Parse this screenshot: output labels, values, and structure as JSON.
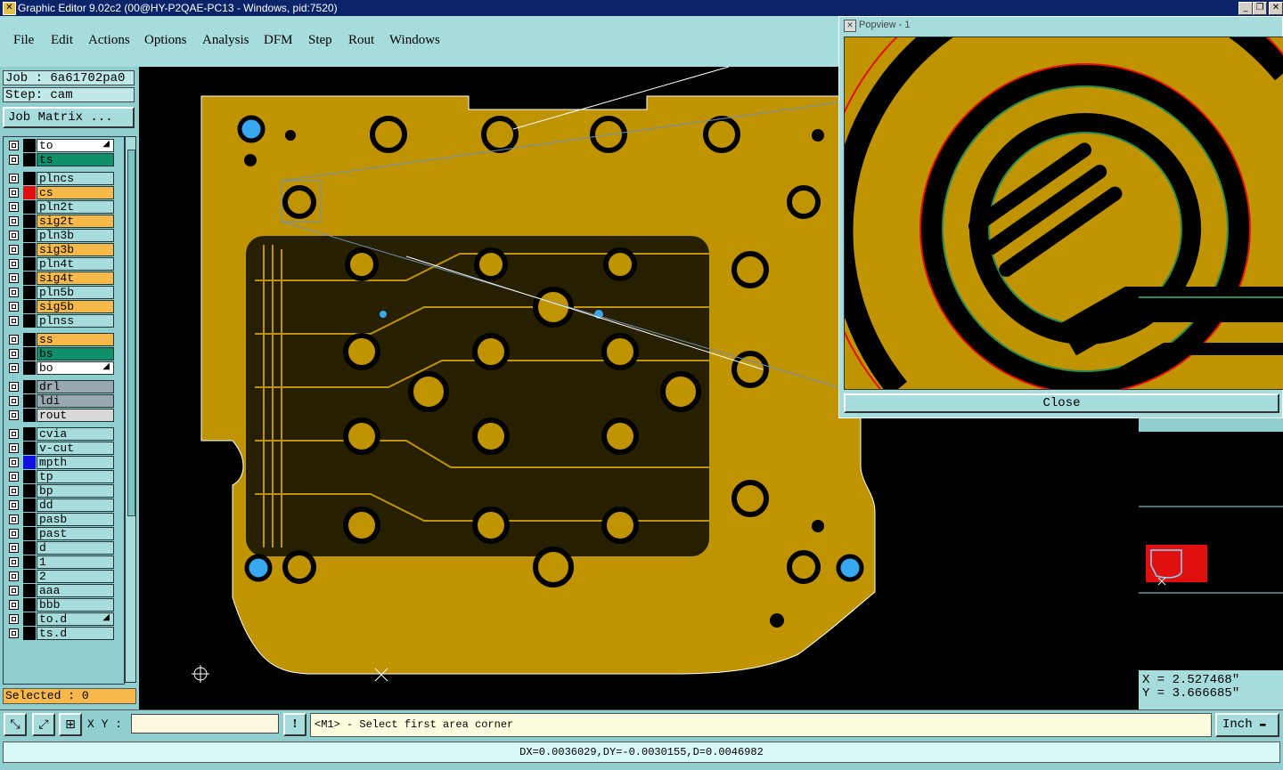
{
  "window": {
    "title": "Graphic Editor 9.02c2 (00@HY-P2QAE-PC13 - Windows, pid:7520)"
  },
  "menu": [
    "File",
    "Edit",
    "Actions",
    "Options",
    "Analysis",
    "DFM",
    "Step",
    "Rout",
    "Windows"
  ],
  "job": {
    "job_line": "Job : 6a61702pa0",
    "step_line": "Step: cam",
    "matrix_button": "Job Matrix ..."
  },
  "layers": [
    {
      "name": "to",
      "color": "#ffffff",
      "swatch": "#000000",
      "arrow": true
    },
    {
      "name": "ts",
      "color": "#0f8f6a",
      "swatch": "#000000"
    },
    {
      "name": "plncs",
      "color": "#a6dcdc",
      "swatch": "#000000"
    },
    {
      "name": "cs",
      "color": "#f8b94a",
      "swatch": "#e01010"
    },
    {
      "name": "pln2t",
      "color": "#a6dcdc",
      "swatch": "#000000"
    },
    {
      "name": "sig2t",
      "color": "#f8b94a",
      "swatch": "#000000"
    },
    {
      "name": "pln3b",
      "color": "#a6dcdc",
      "swatch": "#000000"
    },
    {
      "name": "sig3b",
      "color": "#f8b94a",
      "swatch": "#000000"
    },
    {
      "name": "pln4t",
      "color": "#a6dcdc",
      "swatch": "#000000"
    },
    {
      "name": "sig4t",
      "color": "#f8b94a",
      "swatch": "#000000"
    },
    {
      "name": "pln5b",
      "color": "#a6dcdc",
      "swatch": "#000000"
    },
    {
      "name": "sig5b",
      "color": "#f8b94a",
      "swatch": "#000000"
    },
    {
      "name": "plnss",
      "color": "#a6dcdc",
      "swatch": "#000000"
    },
    {
      "name": "ss",
      "color": "#f8b94a",
      "swatch": "#000000"
    },
    {
      "name": "bs",
      "color": "#0f8f6a",
      "swatch": "#000000"
    },
    {
      "name": "bo",
      "color": "#ffffff",
      "swatch": "#000000",
      "arrow": true
    },
    {
      "name": "drl",
      "color": "#9aa8b0",
      "swatch": "#000000"
    },
    {
      "name": "ldi",
      "color": "#9aa8b0",
      "swatch": "#000000"
    },
    {
      "name": "rout",
      "color": "#d8d8d8",
      "swatch": "#000000"
    },
    {
      "name": "cvia",
      "color": "#a6dcdc",
      "swatch": "#000000"
    },
    {
      "name": "v-cut",
      "color": "#a6dcdc",
      "swatch": "#000000"
    },
    {
      "name": "mpth",
      "color": "#a6dcdc",
      "swatch": "#1010e0"
    },
    {
      "name": "tp",
      "color": "#a6dcdc",
      "swatch": "#000000"
    },
    {
      "name": "bp",
      "color": "#a6dcdc",
      "swatch": "#000000"
    },
    {
      "name": "dd",
      "color": "#a6dcdc",
      "swatch": "#000000"
    },
    {
      "name": "pasb",
      "color": "#a6dcdc",
      "swatch": "#000000"
    },
    {
      "name": "past",
      "color": "#a6dcdc",
      "swatch": "#000000"
    },
    {
      "name": "d",
      "color": "#a6dcdc",
      "swatch": "#000000"
    },
    {
      "name": "1",
      "color": "#a6dcdc",
      "swatch": "#000000"
    },
    {
      "name": "2",
      "color": "#a6dcdc",
      "swatch": "#000000"
    },
    {
      "name": "aaa",
      "color": "#a6dcdc",
      "swatch": "#000000"
    },
    {
      "name": "bbb",
      "color": "#a6dcdc",
      "swatch": "#000000"
    },
    {
      "name": "to.d",
      "color": "#a6dcdc",
      "swatch": "#000000",
      "arrow": true
    },
    {
      "name": "ts.d",
      "color": "#a6dcdc",
      "swatch": "#000000"
    }
  ],
  "selected": "Selected : 0",
  "popview": {
    "title": "Popview - 1",
    "close_label": "Close"
  },
  "coords": {
    "x_line": "X = 2.527468\"",
    "y_line": "Y = 3.666685\""
  },
  "bottom": {
    "xy_label": "X Y :",
    "xy_value": "",
    "warn_label": "!",
    "prompt": "<M1> - Select first area corner",
    "units": "Inch",
    "units_arrow": "▬"
  },
  "status": "DX=0.0036029,DY=-0.0030155,D=0.0046982",
  "colors": {
    "board": "#bf9400",
    "menu_bg": "#a6dcdc",
    "panel_bg": "#8fcfcf",
    "highlight": "#f8b94a",
    "title_bg": "#0a246a"
  }
}
